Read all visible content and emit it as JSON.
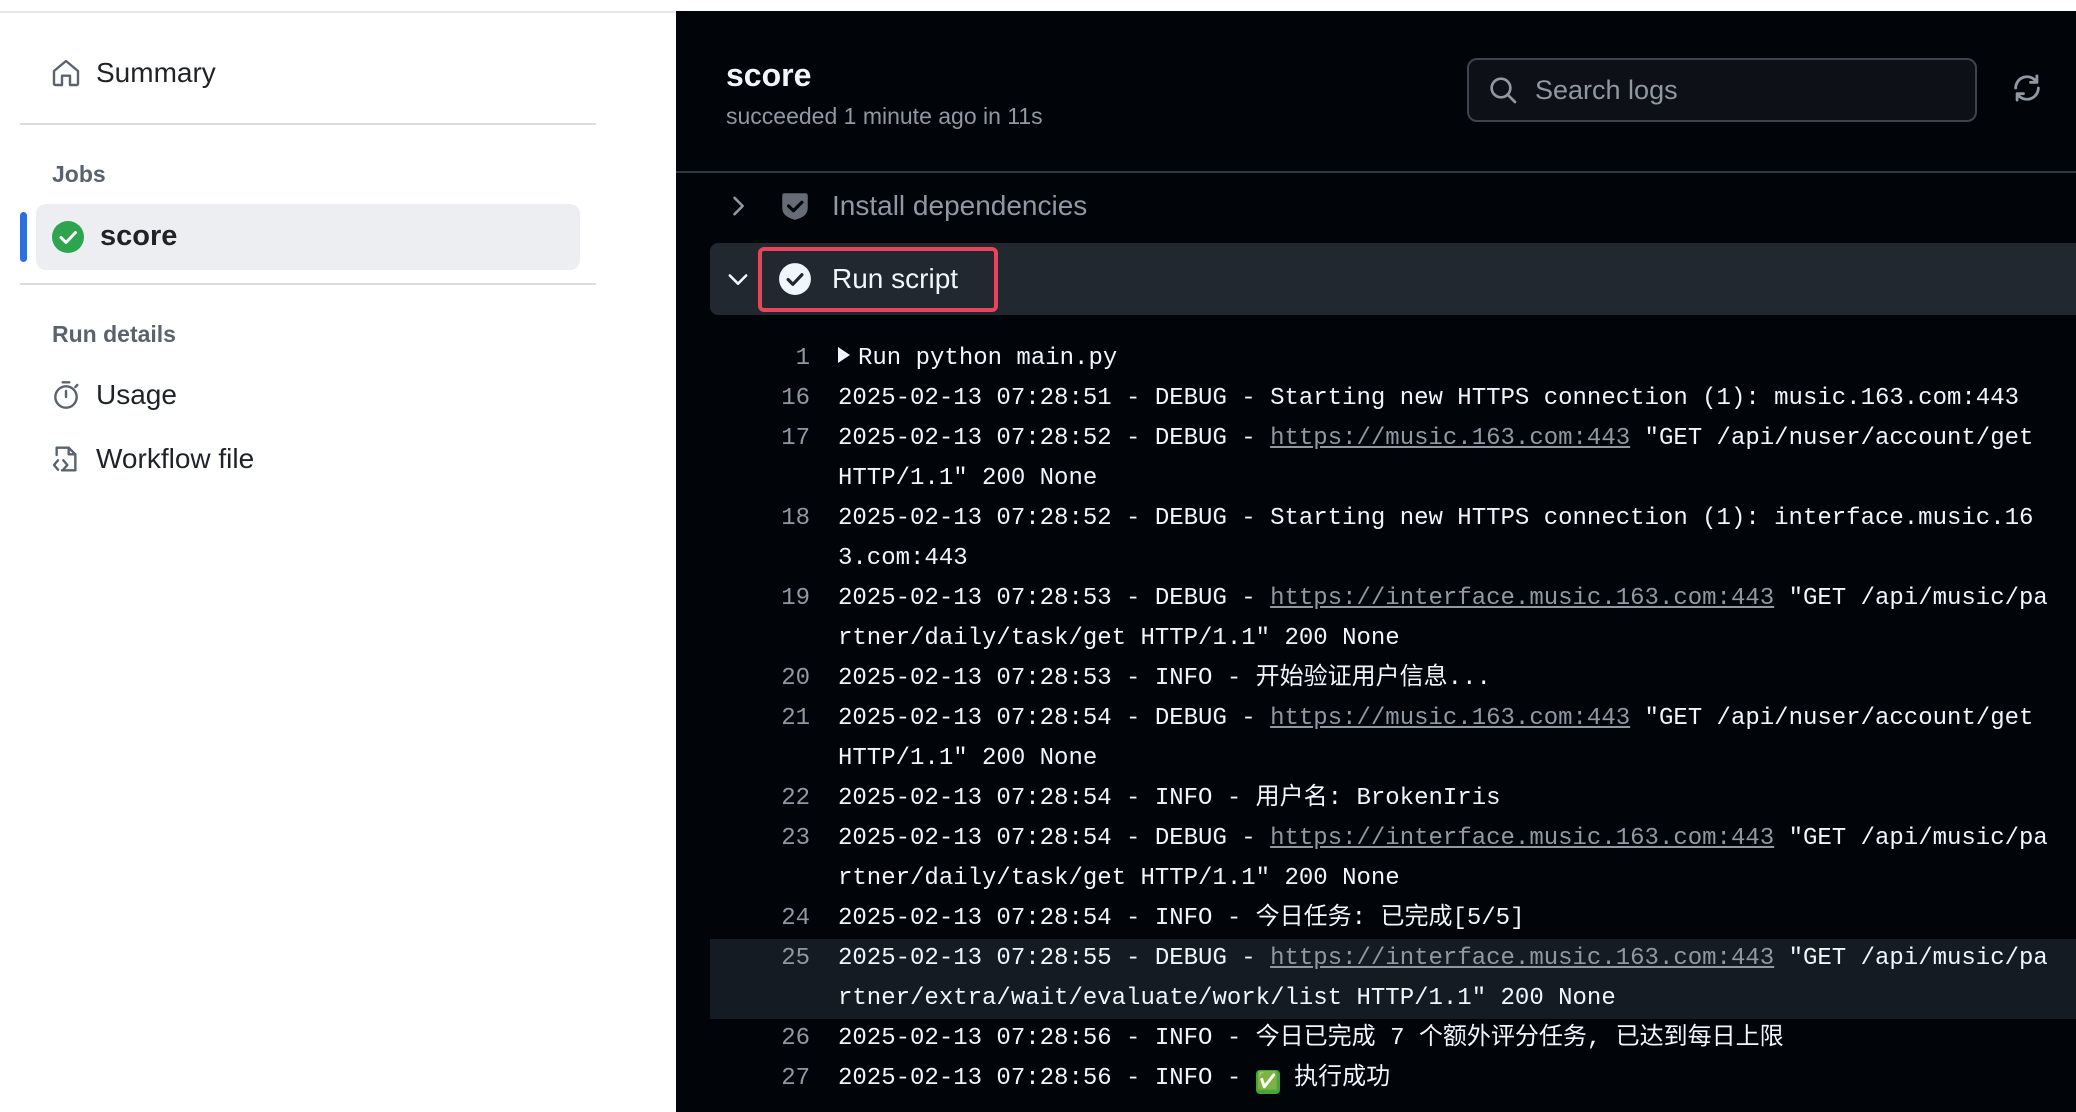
{
  "sidebar": {
    "summary_label": "Summary",
    "jobs_heading": "Jobs",
    "active_job": "score",
    "run_details_heading": "Run details",
    "usage_label": "Usage",
    "workflow_file_label": "Workflow file"
  },
  "header": {
    "job_title": "score",
    "status": "succeeded 1 minute ago in 11s",
    "search_placeholder": "Search logs"
  },
  "steps": {
    "collapsed": "Install dependencies",
    "expanded": "Run script"
  },
  "colors": {
    "success": "#2da44e",
    "highlight_border": "#e8455a",
    "active_indicator": "#2f6fdd"
  },
  "log_lines": [
    {
      "num": "1",
      "text": "Run python main.py"
    },
    {
      "num": "16",
      "text": "2025-02-13 07:28:51 - DEBUG - Starting new HTTPS connection (1): music.163.com:443"
    },
    {
      "num": "17",
      "prefix": "2025-02-13 07:28:52 - DEBUG - ",
      "link": "https://music.163.com:443",
      "suffix": " \"GET /api/nuser/account/get HTTP/1.1\" 200 None"
    },
    {
      "num": "18",
      "text": "2025-02-13 07:28:52 - DEBUG - Starting new HTTPS connection (1): interface.music.163.com:443"
    },
    {
      "num": "19",
      "prefix": "2025-02-13 07:28:53 - DEBUG - ",
      "link": "https://interface.music.163.com:443",
      "suffix": " \"GET /api/music/partner/daily/task/get HTTP/1.1\" 200 None"
    },
    {
      "num": "20",
      "text": "2025-02-13 07:28:53 - INFO - 开始验证用户信息..."
    },
    {
      "num": "21",
      "prefix": "2025-02-13 07:28:54 - DEBUG - ",
      "link": "https://music.163.com:443",
      "suffix": " \"GET /api/nuser/account/get HTTP/1.1\" 200 None"
    },
    {
      "num": "22",
      "text": "2025-02-13 07:28:54 - INFO - 用户名: BrokenIris"
    },
    {
      "num": "23",
      "prefix": "2025-02-13 07:28:54 - DEBUG - ",
      "link": "https://interface.music.163.com:443",
      "suffix": " \"GET /api/music/partner/daily/task/get HTTP/1.1\" 200 None"
    },
    {
      "num": "24",
      "text": "2025-02-13 07:28:54 - INFO - 今日任务: 已完成[5/5]"
    },
    {
      "num": "25",
      "prefix": "2025-02-13 07:28:55 - DEBUG - ",
      "link": "https://interface.music.163.com:443",
      "suffix": " \"GET /api/music/partner/extra/wait/evaluate/work/list HTTP/1.1\" 200 None"
    },
    {
      "num": "26",
      "text": "2025-02-13 07:28:56 - INFO - 今日已完成 7 个额外评分任务, 已达到每日上限"
    },
    {
      "num": "27",
      "prefix": "2025-02-13 07:28:56 - INFO - ",
      "emoji": "✅",
      "suffix": " 执行成功"
    }
  ]
}
